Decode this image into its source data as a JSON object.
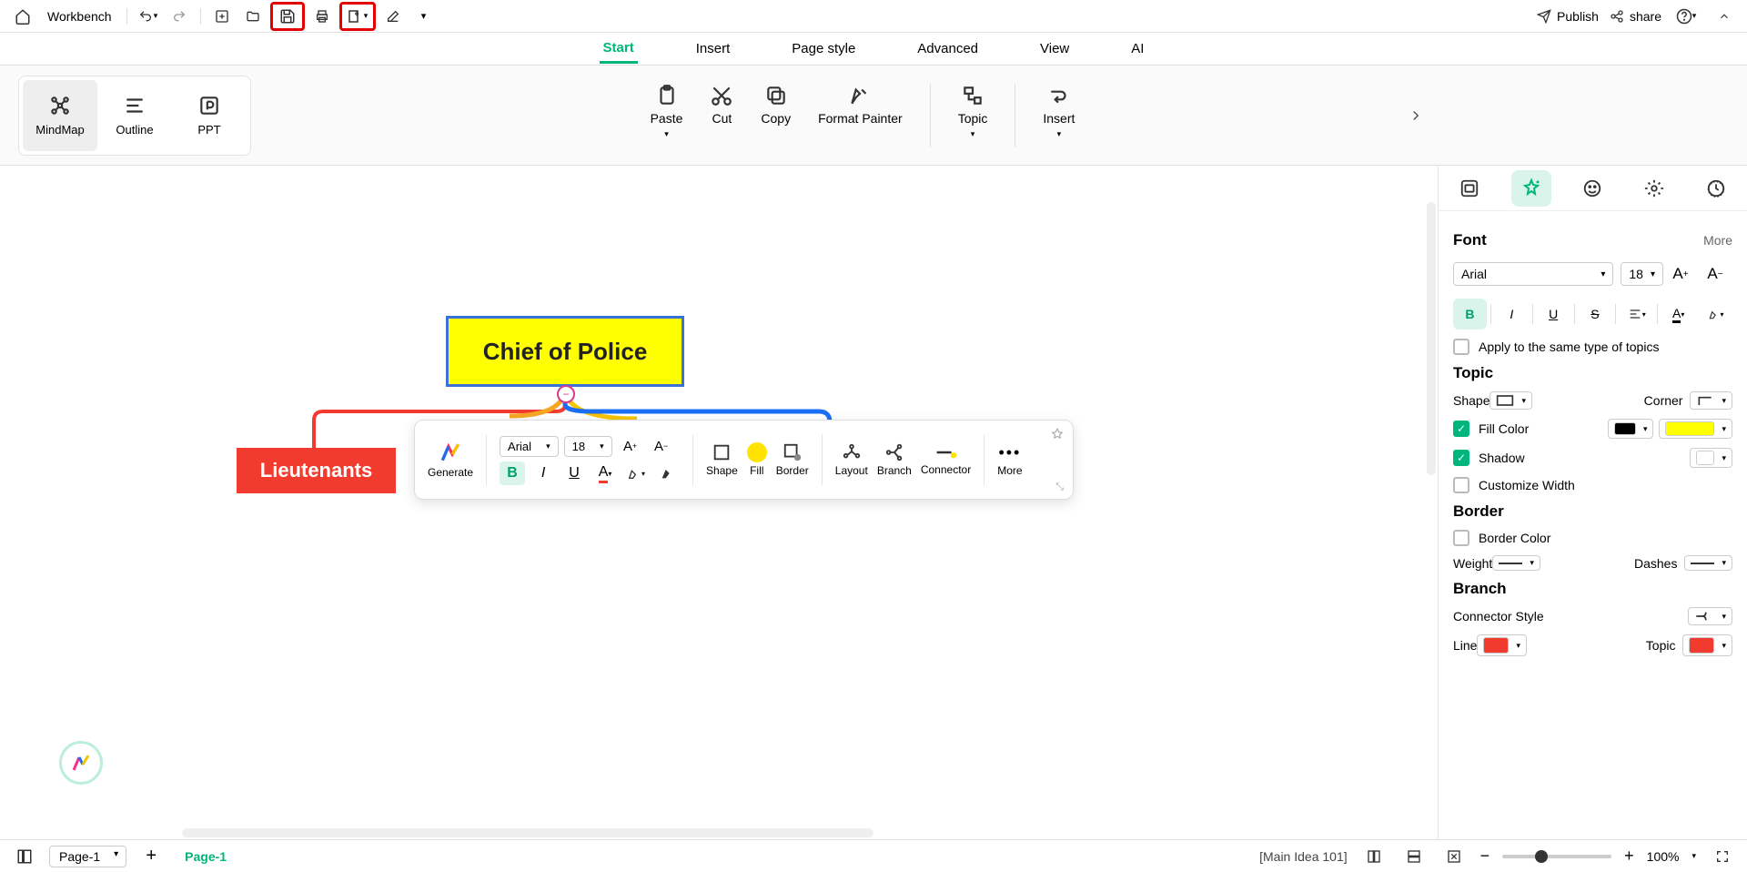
{
  "top": {
    "workbench": "Workbench"
  },
  "topRight": {
    "publish": "Publish",
    "share": "share"
  },
  "menu": {
    "start": "Start",
    "insert": "Insert",
    "pageStyle": "Page style",
    "advanced": "Advanced",
    "view": "View",
    "ai": "AI"
  },
  "viewModes": {
    "mindmap": "MindMap",
    "outline": "Outline",
    "ppt": "PPT"
  },
  "ribbon": {
    "paste": "Paste",
    "cut": "Cut",
    "copy": "Copy",
    "formatPainter": "Format Painter",
    "topic": "Topic",
    "insert": "Insert"
  },
  "canvas": {
    "root": "Chief of Police",
    "lieutenants": "Lieutenants"
  },
  "float": {
    "generate": "Generate",
    "font": "Arial",
    "size": "18",
    "shape": "Shape",
    "fill": "Fill",
    "border": "Border",
    "layout": "Layout",
    "branch": "Branch",
    "connector": "Connector",
    "more": "More"
  },
  "panel": {
    "fontHead": "Font",
    "more": "More",
    "font": "Arial",
    "size": "18",
    "apply": "Apply to the same type of topics",
    "topicHead": "Topic",
    "shape": "Shape",
    "corner": "Corner",
    "fillColor": "Fill Color",
    "shadow": "Shadow",
    "customWidth": "Customize Width",
    "borderHead": "Border",
    "borderColor": "Border Color",
    "weight": "Weight",
    "dashes": "Dashes",
    "branchHead": "Branch",
    "connStyle": "Connector Style",
    "line": "Line",
    "topic": "Topic"
  },
  "bottom": {
    "pageSel": "Page-1",
    "pageTab": "Page-1",
    "mainIdea": "[Main Idea 101]",
    "zoom": "100%"
  }
}
